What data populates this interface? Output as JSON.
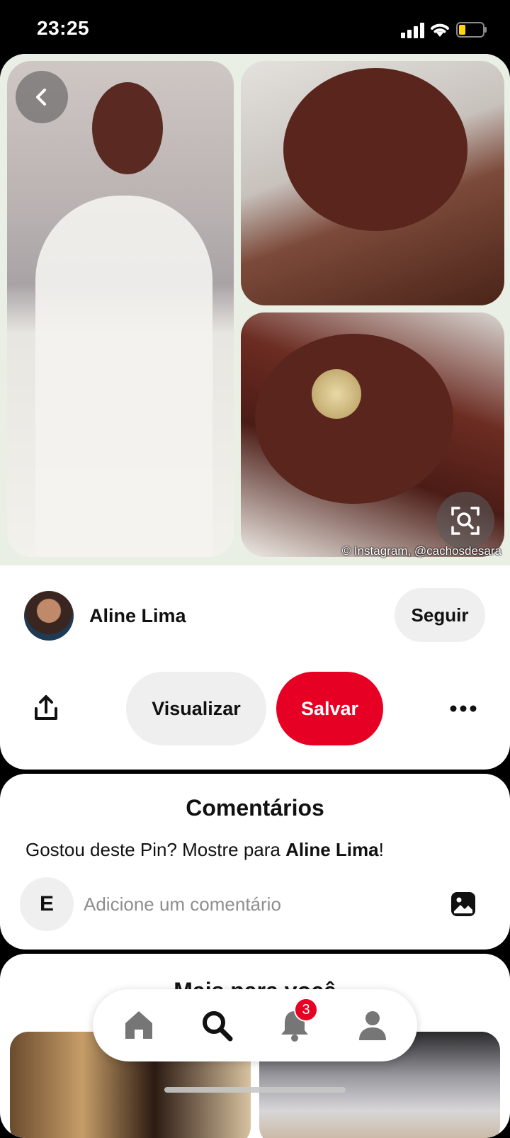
{
  "status_bar": {
    "time": "23:25",
    "icons": [
      "signal-icon",
      "wifi-icon",
      "battery-icon"
    ],
    "battery_color": "#ffd60a"
  },
  "pin": {
    "image_credit": "© Instagram, @cachosdesara",
    "icons": {
      "back": "chevron-left-icon",
      "visual_search": "lens-search-icon"
    }
  },
  "author": {
    "name": "Aline Lima",
    "follow_label": "Seguir"
  },
  "actions": {
    "view_label": "Visualizar",
    "save_label": "Salvar",
    "icons": {
      "share": "share-icon",
      "more": "more-dots-icon"
    },
    "save_color": "#e60023"
  },
  "comments": {
    "title": "Comentários",
    "prompt_prefix": "Gostou deste Pin? Mostre para ",
    "prompt_name": "Aline Lima",
    "prompt_suffix": "!",
    "user_initial": "E",
    "input_placeholder": "Adicione um comentário",
    "input_value": ""
  },
  "more_ideas": {
    "title": "Mais para você"
  },
  "bottom_nav": {
    "items": [
      {
        "name": "home",
        "icon": "home-icon"
      },
      {
        "name": "search",
        "icon": "search-icon",
        "active": true
      },
      {
        "name": "notifications",
        "icon": "bell-icon",
        "badge": "3"
      },
      {
        "name": "profile",
        "icon": "person-icon"
      }
    ]
  }
}
